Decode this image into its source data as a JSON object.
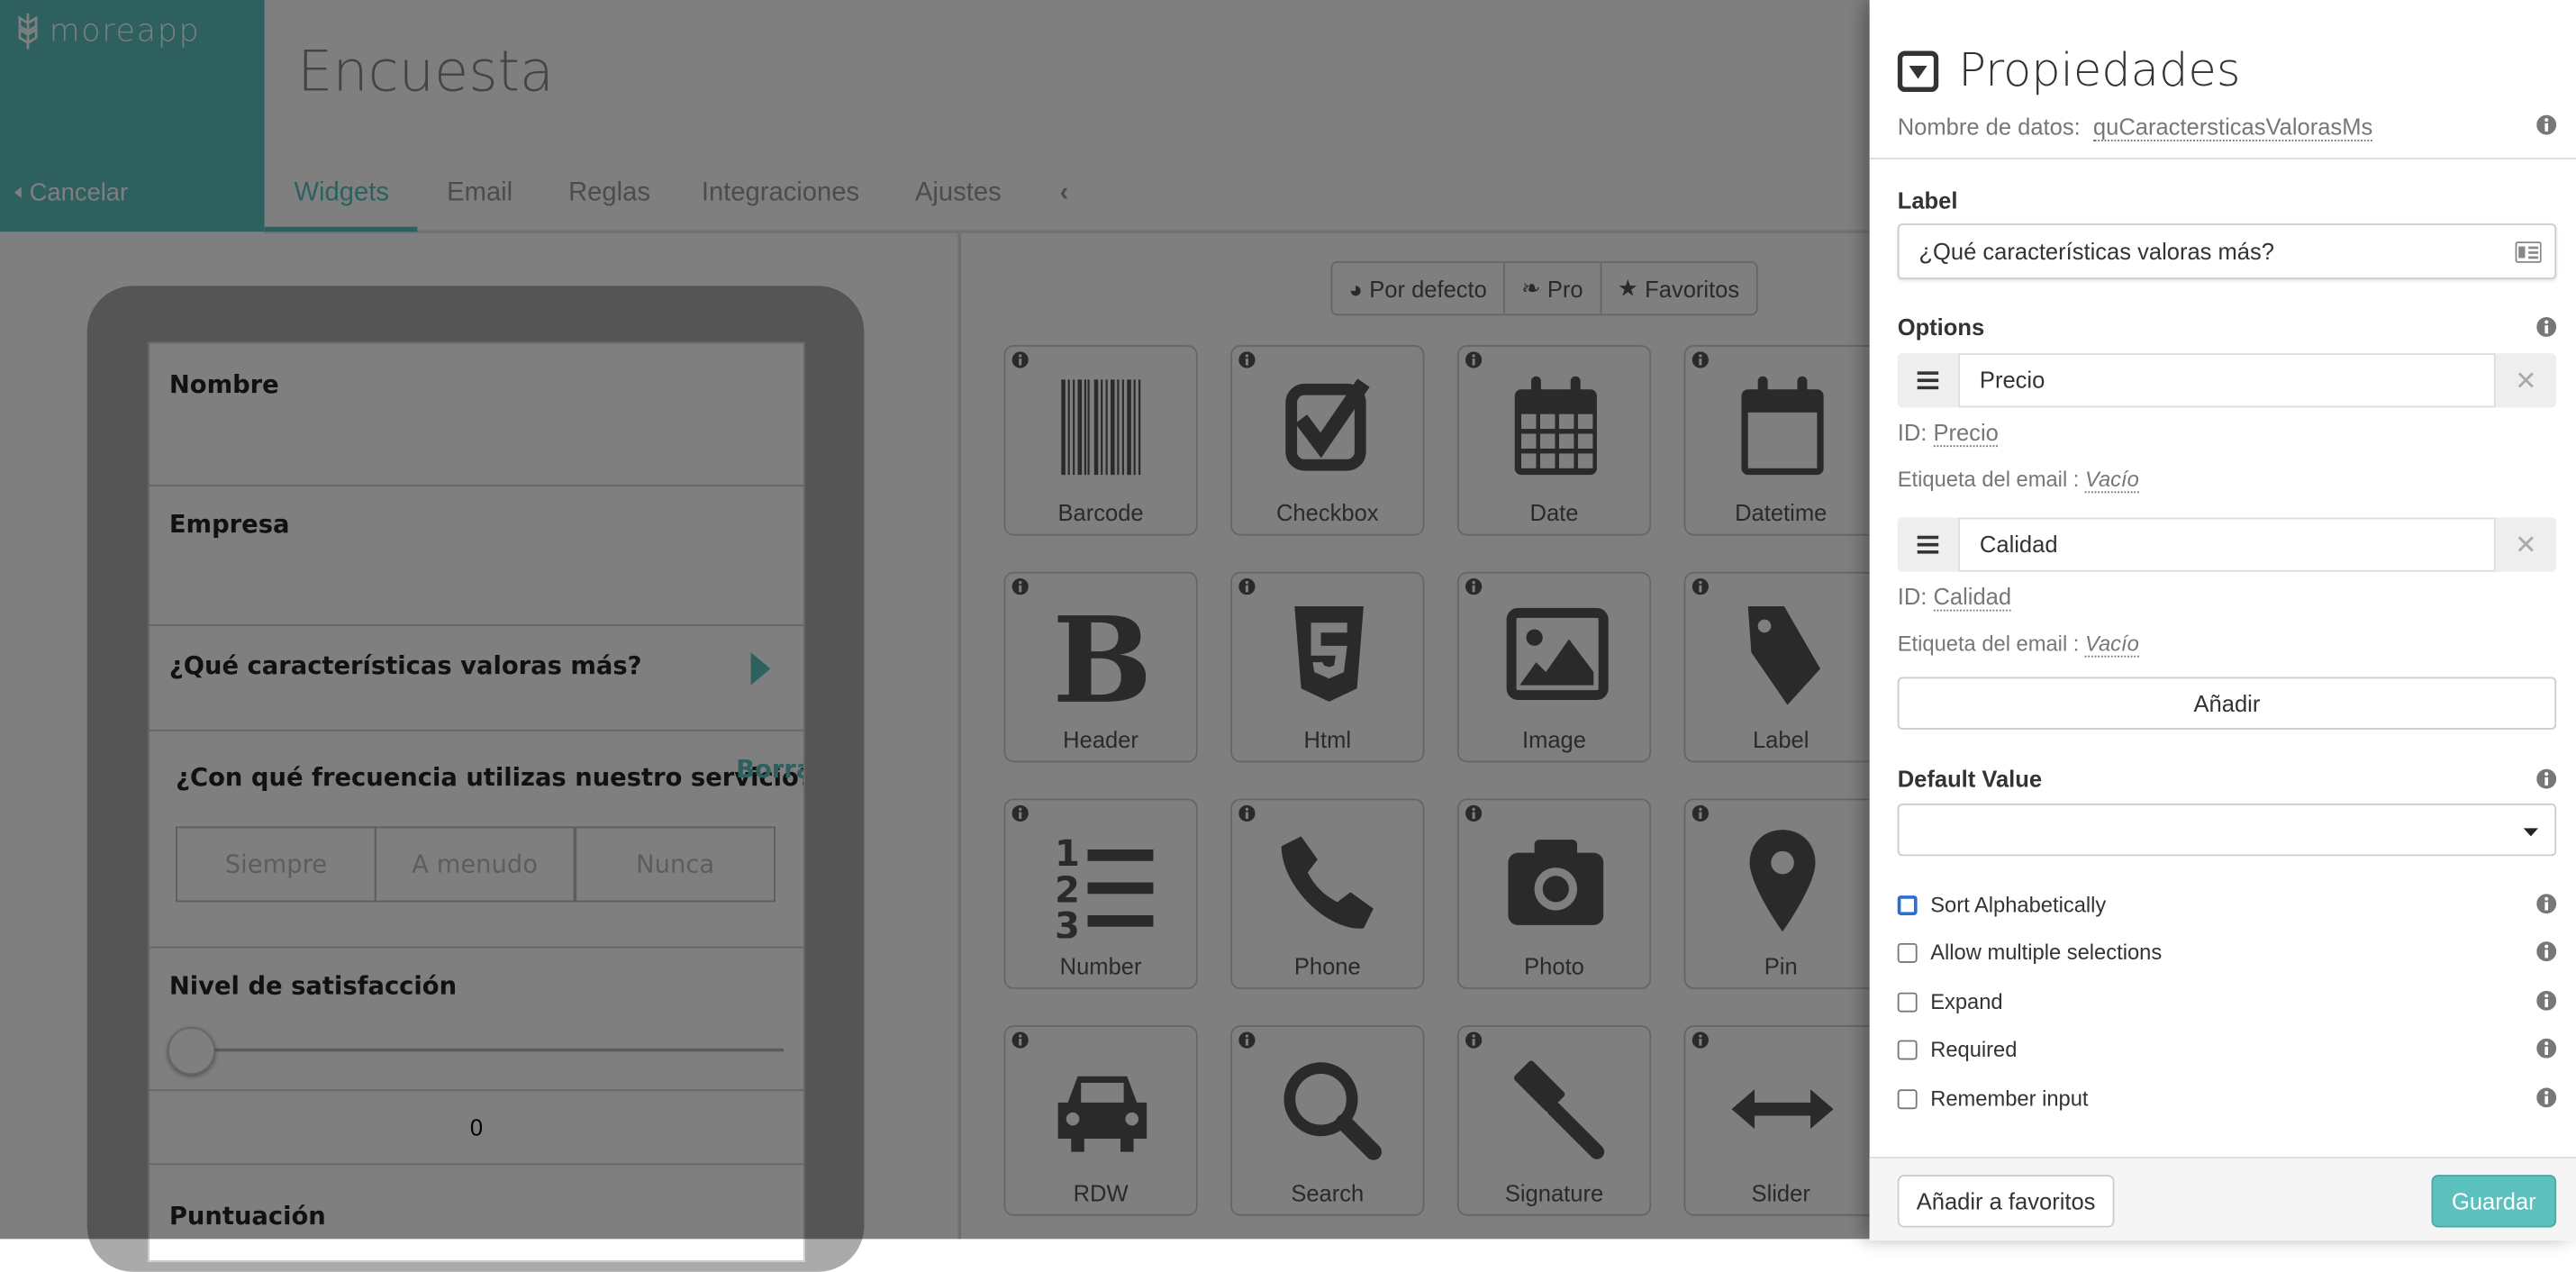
{
  "app": {
    "logo_text": "moreapp",
    "cancel_label": "Cancelar",
    "title": "Encuesta",
    "accent": "#5bc0be"
  },
  "tabs": [
    {
      "label": "Widgets",
      "active": true
    },
    {
      "label": "Email"
    },
    {
      "label": "Reglas"
    },
    {
      "label": "Integraciones"
    },
    {
      "label": "Ajustes"
    }
  ],
  "form_preview": {
    "fields": [
      "Nombre",
      "Empresa",
      "¿Qué características valoras más?",
      "¿Con qué frecuencia utilizas nuestro servicio?",
      "Nivel de satisfacción",
      "Puntuación"
    ],
    "clear_link": "Borrar",
    "segments": [
      "Siempre",
      "A menudo",
      "Nunca"
    ],
    "slider_value": "0"
  },
  "widget_filters": [
    "Por defecto",
    "Pro",
    "Favoritos"
  ],
  "widget_tiles": [
    "Barcode",
    "Checkbox",
    "Date",
    "Datetime",
    "Header",
    "Html",
    "Image",
    "Label",
    "Number",
    "Phone",
    "Photo",
    "Pin",
    "RDW",
    "Search",
    "Signature",
    "Slider"
  ],
  "properties": {
    "title": "Propiedades",
    "data_name_label": "Nombre de datos:",
    "data_name_value": "quCaractersticasValorasMs",
    "label_heading": "Label",
    "label_value": "¿Qué características valoras más?",
    "options_heading": "Options",
    "options": [
      {
        "value": "Precio",
        "id_label": "ID:",
        "id": "Precio",
        "email_label": "Etiqueta del email :",
        "email": "Vacío"
      },
      {
        "value": "Calidad",
        "id_label": "ID:",
        "id": "Calidad",
        "email_label": "Etiqueta del email :",
        "email": "Vacío"
      }
    ],
    "add_label": "Añadir",
    "default_heading": "Default Value",
    "default_value": "",
    "checkboxes": [
      {
        "label": "Sort Alphabetically",
        "checked": false
      },
      {
        "label": "Allow multiple selections",
        "checked": false
      },
      {
        "label": "Expand",
        "checked": false
      },
      {
        "label": "Required",
        "checked": false
      },
      {
        "label": "Remember input",
        "checked": false
      }
    ],
    "favorite_label": "Añadir a favoritos",
    "save_label": "Guardar"
  }
}
